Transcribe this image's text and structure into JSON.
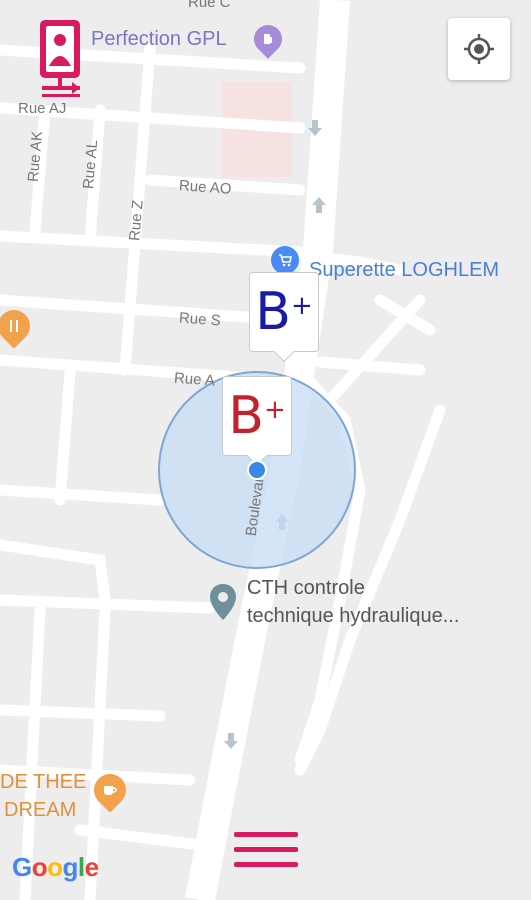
{
  "streets": {
    "rue_c": "Rue C",
    "rue_aj": "Rue AJ",
    "rue_ak": "Rue AK",
    "rue_al": "Rue AL",
    "rue_z": "Rue Z",
    "rue_ao": "Rue AO",
    "rue_s": "Rue S",
    "rue_a": "Rue A",
    "boulevard": "Boulevard"
  },
  "pois": {
    "perfection_gpl": "Perfection GPL",
    "superette": "Superette LOGHLEM",
    "cth_line1": "CTH controle",
    "cth_line2": "technique hydraulique...",
    "cafe_line1": "DE THEE",
    "cafe_line2": "DREAM"
  },
  "markers": {
    "blue": {
      "letter": "B",
      "sup": "+",
      "color": "#1a1aa8"
    },
    "red": {
      "letter": "B",
      "sup": "+",
      "color": "#c0232c"
    }
  },
  "colors": {
    "brand": "#d81b60",
    "poi_blue": "#4a8af4",
    "poi_orange": "#f2a24b",
    "poi_gray": "#6f8f9a",
    "accuracy_fill": "#c6dcf4",
    "location_dot": "#3a87e8"
  },
  "icons": {
    "app": "blood-donor-app-icon",
    "locate": "my-location-icon",
    "menu": "hamburger-menu-icon"
  },
  "attribution": {
    "google": [
      "G",
      "o",
      "o",
      "g",
      "l",
      "e"
    ]
  }
}
